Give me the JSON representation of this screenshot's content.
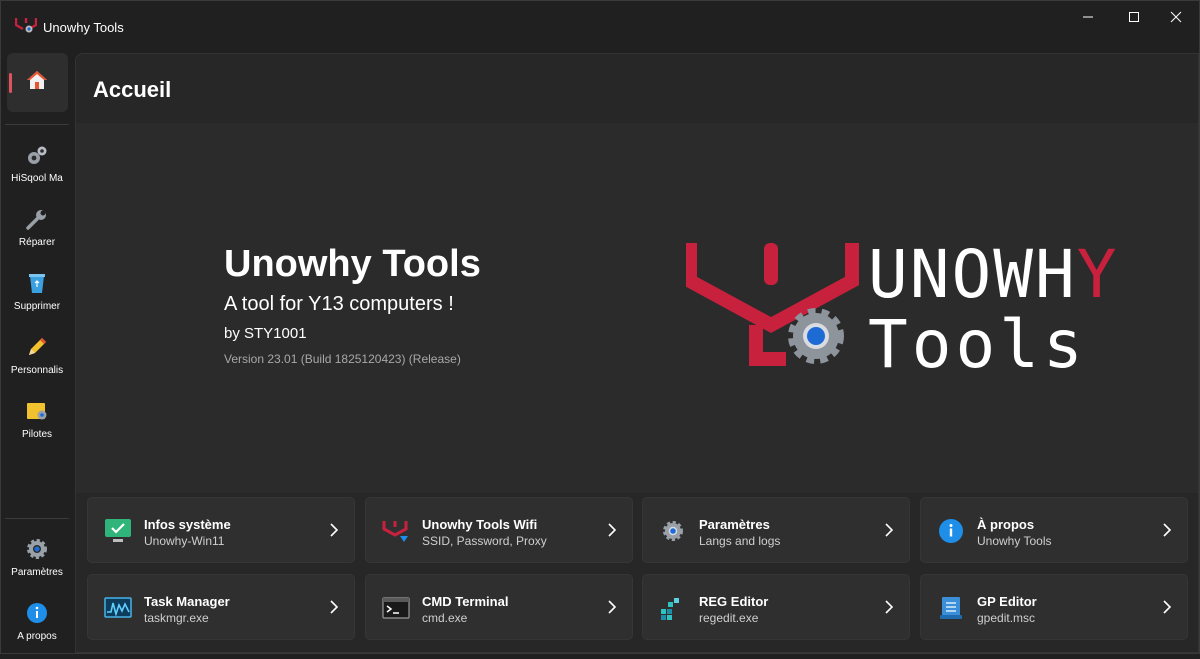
{
  "window": {
    "title": "Unowhy Tools",
    "controls": [
      "minimize",
      "maximize",
      "close"
    ]
  },
  "sidebar": {
    "items": [
      {
        "label": "HiSqool Ma",
        "icon": "gears-icon"
      },
      {
        "label": "Réparer",
        "icon": "wrench-icon"
      },
      {
        "label": "Supprimer",
        "icon": "recycle-bin-icon"
      },
      {
        "label": "Personnalis",
        "icon": "pencil-icon"
      },
      {
        "label": "Pilotes",
        "icon": "driver-folder-icon"
      }
    ],
    "footer": [
      {
        "label": "Paramètres",
        "icon": "gear-icon"
      },
      {
        "label": "A propos",
        "icon": "info-icon"
      }
    ]
  },
  "page": {
    "title": "Accueil"
  },
  "hero": {
    "title": "Unowhy Tools",
    "subtitle": "A tool for Y13 computers !",
    "author": "by STY1001",
    "version": "Version 23.01 (Build 1825120423) (Release)",
    "logo_line1": "UNOWHY",
    "logo_line2": "Tools"
  },
  "cards": [
    {
      "title": "Infos système",
      "subtitle": "Unowhy-Win11",
      "icon": "monitor-check-icon"
    },
    {
      "title": "Unowhy Tools Wifi",
      "subtitle": "SSID, Password, Proxy",
      "icon": "unowhy-wifi-icon"
    },
    {
      "title": "Paramètres",
      "subtitle": "Langs and logs",
      "icon": "gear-icon"
    },
    {
      "title": "À propos",
      "subtitle": "Unowhy Tools",
      "icon": "info-icon"
    },
    {
      "title": "Task Manager",
      "subtitle": "taskmgr.exe",
      "icon": "task-manager-icon"
    },
    {
      "title": "CMD Terminal",
      "subtitle": "cmd.exe",
      "icon": "terminal-icon"
    },
    {
      "title": "REG Editor",
      "subtitle": "regedit.exe",
      "icon": "registry-icon"
    },
    {
      "title": "GP Editor",
      "subtitle": "gpedit.msc",
      "icon": "policy-document-icon"
    }
  ],
  "colors": {
    "brand_red": "#c8213e",
    "accent_blue": "#1e6bd6",
    "background": "#202020"
  }
}
